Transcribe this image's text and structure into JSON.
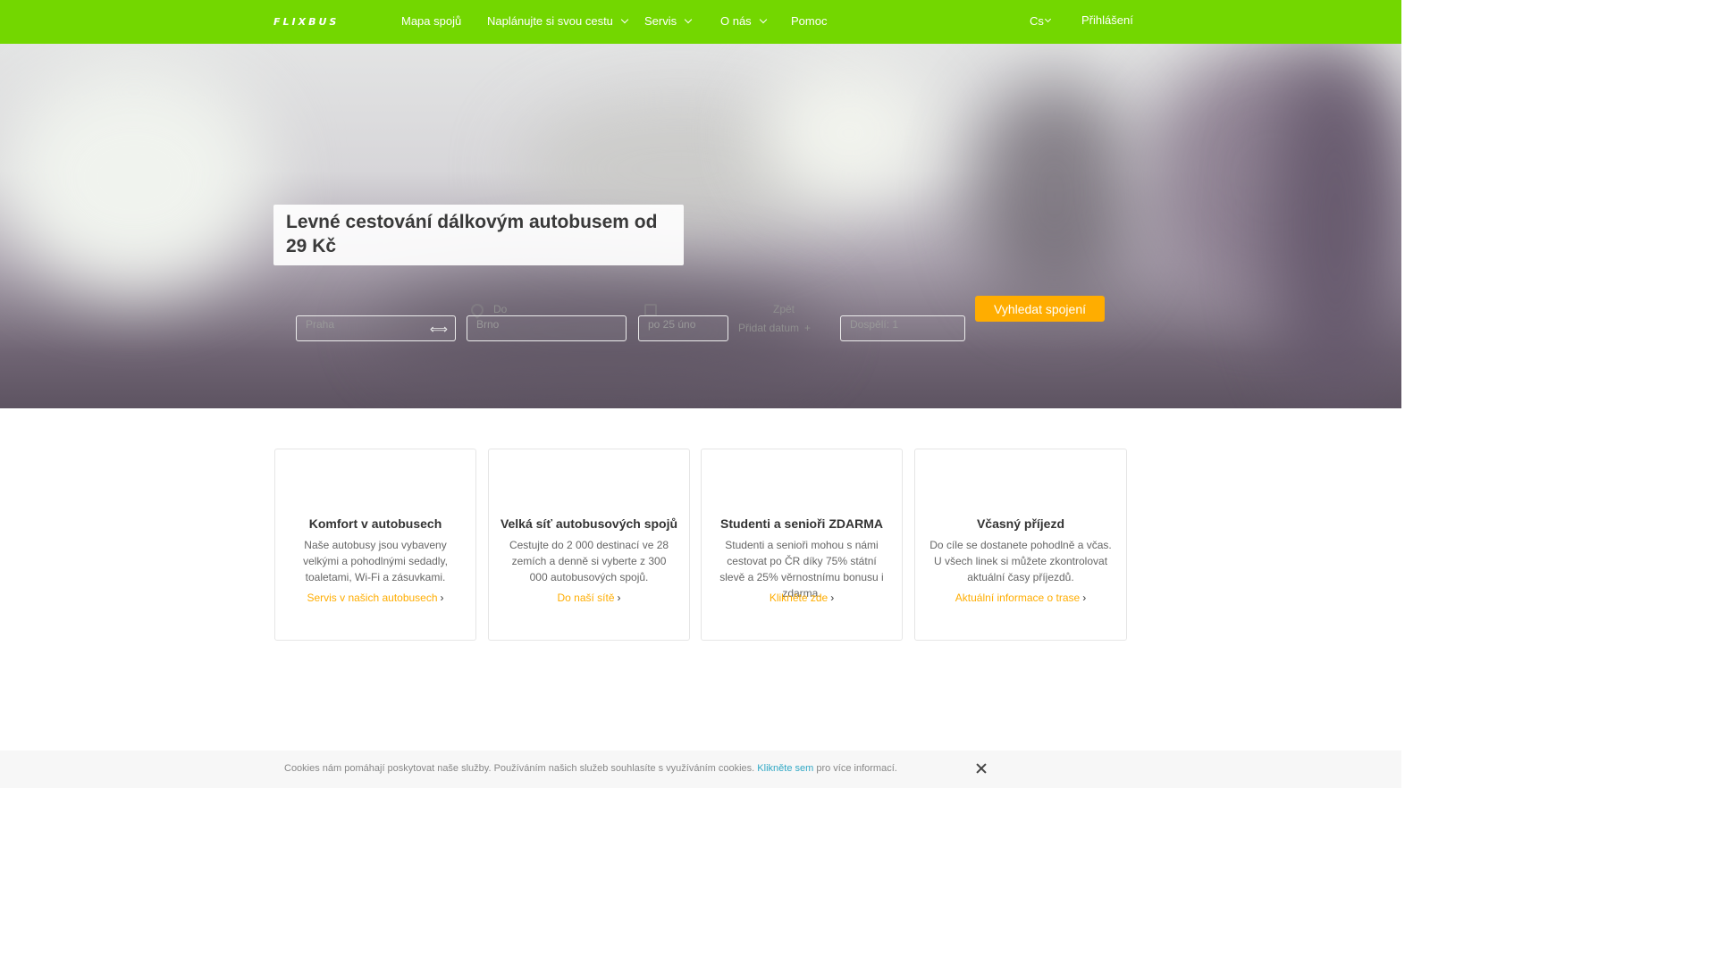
{
  "nav": {
    "logo": "FLIXBUS",
    "items": [
      {
        "label": "Mapa spojů",
        "dropdown": false
      },
      {
        "label": "Naplánujte si svou cestu",
        "dropdown": true
      },
      {
        "label": "Servis",
        "dropdown": true
      },
      {
        "label": "O nás",
        "dropdown": true
      },
      {
        "label": "Pomoc",
        "dropdown": false
      }
    ],
    "language": "Cs",
    "login": "Přihlášení"
  },
  "hero": {
    "title": "Levné cestování dálkovým autobusem od 29 Kč"
  },
  "search": {
    "from_value": "Praha",
    "to_label": "Do",
    "to_value": "Brno",
    "date_value": "po 25 úno",
    "return_label": "Zpět",
    "add_date": "Přidat datum",
    "passengers_value": "Dospělí: 1",
    "button": "Vyhledat spojení"
  },
  "cards": [
    {
      "title": "Komfort v autobusech",
      "text": "Naše autobusy jsou vybaveny velkými a pohodlnými sedadly, toaletami, Wi-Fi a zásuvkami.",
      "link": "Servis v našich autobusech"
    },
    {
      "title": "Velká síť autobusových spojů",
      "text": "Cestujte do 2 000 destinací ve 28 zemích a denně si vyberte z 300 000 autobusových spojů.",
      "link": "Do naší sítě"
    },
    {
      "title": "Studenti a senioři ZDARMA",
      "text": "Studenti a senioři mohou s námi cestovat po ČR díky 75% státní slevě a 25% věrnostnímu bonusu i zdarma.",
      "link": "Klikněte zde"
    },
    {
      "title": "Včasný příjezd",
      "text": "Do cíle se dostanete pohodlně a včas. U všech linek si můžete zkontrolovat aktuální časy příjezdů.",
      "link": "Aktuální informace o trase"
    }
  ],
  "cookie": {
    "text_before": "Cookies nám pomáhají poskytovat naše služby. Používáním našich služeb souhlasíte s využíváním cookies.",
    "link": "Klikněte sem",
    "text_after": "pro více informací."
  },
  "colors": {
    "brand_green": "#73d700",
    "accent_orange": "#ffad00",
    "link_blue": "#31a8c5"
  }
}
